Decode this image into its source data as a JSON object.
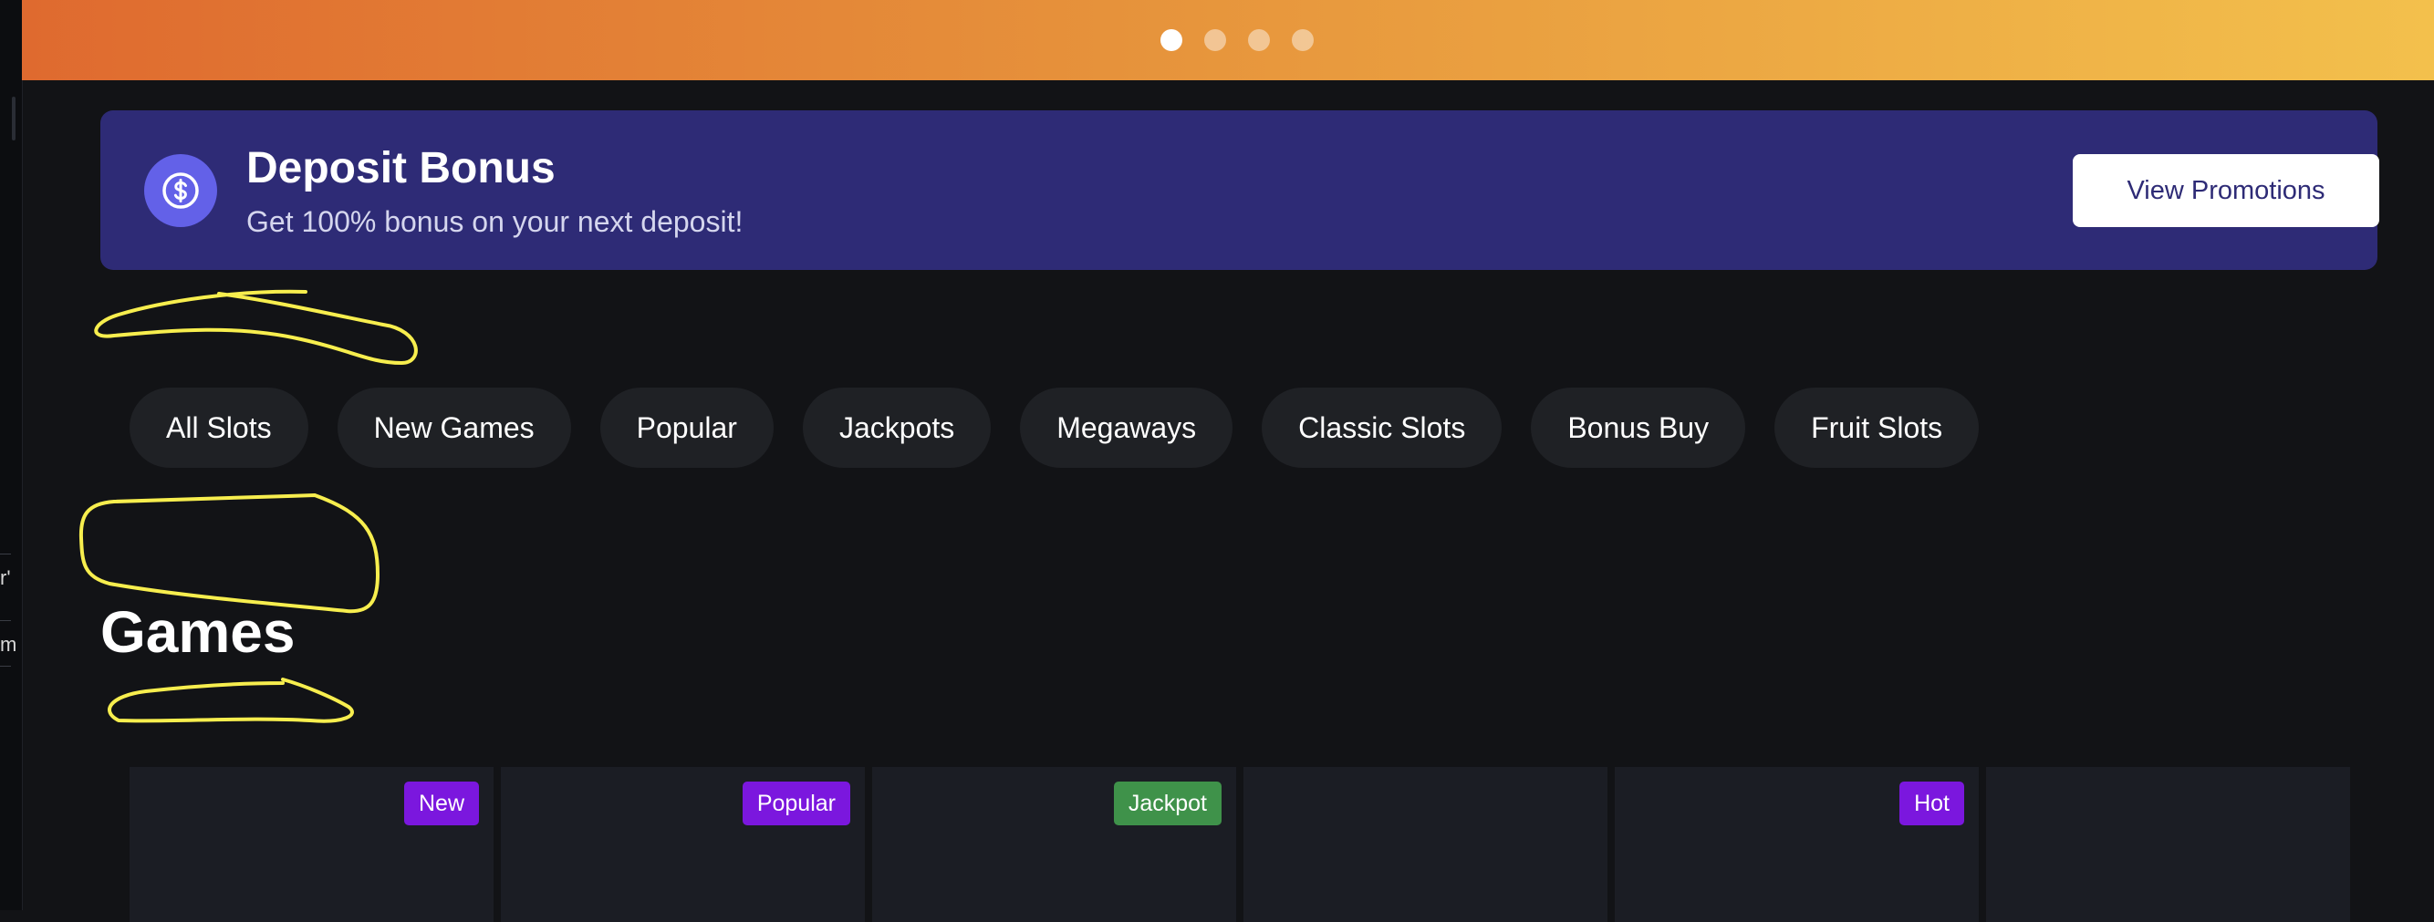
{
  "colors": {
    "page_background": "#121316",
    "promo_background": "#2e2b76",
    "promo_icon_background": "#6361e8",
    "hero_gradient": [
      "#df6a2f",
      "#e6923b",
      "#f3c04c"
    ],
    "chip_background": "#1f2125",
    "card_background": "#1b1d24",
    "annotation_yellow": "#f7ee4e"
  },
  "left_edge": {
    "fragments": [
      "r'",
      "m"
    ]
  },
  "carousel": {
    "slide_count": 4,
    "active_index": 0
  },
  "promo": {
    "icon": "dollar-circle-icon",
    "title": "Deposit Bonus",
    "subtitle": "Get 100% bonus on your next deposit!",
    "button_label": "View Promotions"
  },
  "categories": [
    {
      "label": "All Slots"
    },
    {
      "label": "New Games"
    },
    {
      "label": "Popular"
    },
    {
      "label": "Jackpots"
    },
    {
      "label": "Megaways"
    },
    {
      "label": "Classic Slots"
    },
    {
      "label": "Bonus Buy"
    },
    {
      "label": "Fruit Slots"
    }
  ],
  "games_section": {
    "title": "Games"
  },
  "games": [
    {
      "badge": "New",
      "badge_color": "#7b17de"
    },
    {
      "badge": "Popular",
      "badge_color": "#7b17de"
    },
    {
      "badge": "Jackpot",
      "badge_color": "#3f924a"
    },
    {
      "badge": "",
      "badge_color": ""
    },
    {
      "badge": "Hot",
      "badge_color": "#7b17de"
    },
    {
      "badge": "",
      "badge_color": ""
    }
  ]
}
